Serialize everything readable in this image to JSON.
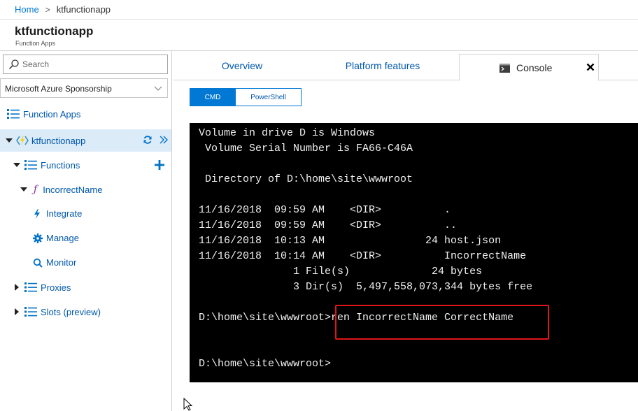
{
  "breadcrumb": {
    "home": "Home",
    "separator": ">",
    "current": "ktfunctionapp"
  },
  "header": {
    "title": "ktfunctionapp",
    "subtitle": "Function Apps"
  },
  "sidebar": {
    "search_placeholder": "Search",
    "subscription": "Microsoft Azure Sponsorship",
    "items": {
      "function_apps": "Function Apps",
      "app": "ktfunctionapp",
      "functions": "Functions",
      "incorrect_name": "IncorrectName",
      "integrate": "Integrate",
      "manage": "Manage",
      "monitor": "Monitor",
      "proxies": "Proxies",
      "slots": "Slots (preview)"
    }
  },
  "tabs": {
    "overview": "Overview",
    "platform_features": "Platform features",
    "console": "Console"
  },
  "shell": {
    "cmd": "CMD",
    "powershell": "PowerShell"
  },
  "terminal": {
    "lines": [
      "Volume in drive D is Windows",
      " Volume Serial Number is FA66-C46A",
      " Directory of D:\\home\\site\\wwwroot",
      "11/16/2018  09:59 AM    <DIR>          .",
      "11/16/2018  09:59 AM    <DIR>          ..",
      "11/16/2018  10:13 AM                24 host.json",
      "11/16/2018  10:14 AM    <DIR>          IncorrectName",
      "               1 File(s)             24 bytes",
      "               3 Dir(s)  5,497,558,073,344 bytes free",
      "D:\\home\\site\\wwwroot>ren IncorrectName CorrectName",
      "D:\\home\\site\\wwwroot>"
    ]
  },
  "colors": {
    "accent": "#0078d4",
    "link": "#0058ad",
    "selected_row": "#dcebf8",
    "highlight": "#e0161b",
    "terminal_bg": "#000000"
  }
}
